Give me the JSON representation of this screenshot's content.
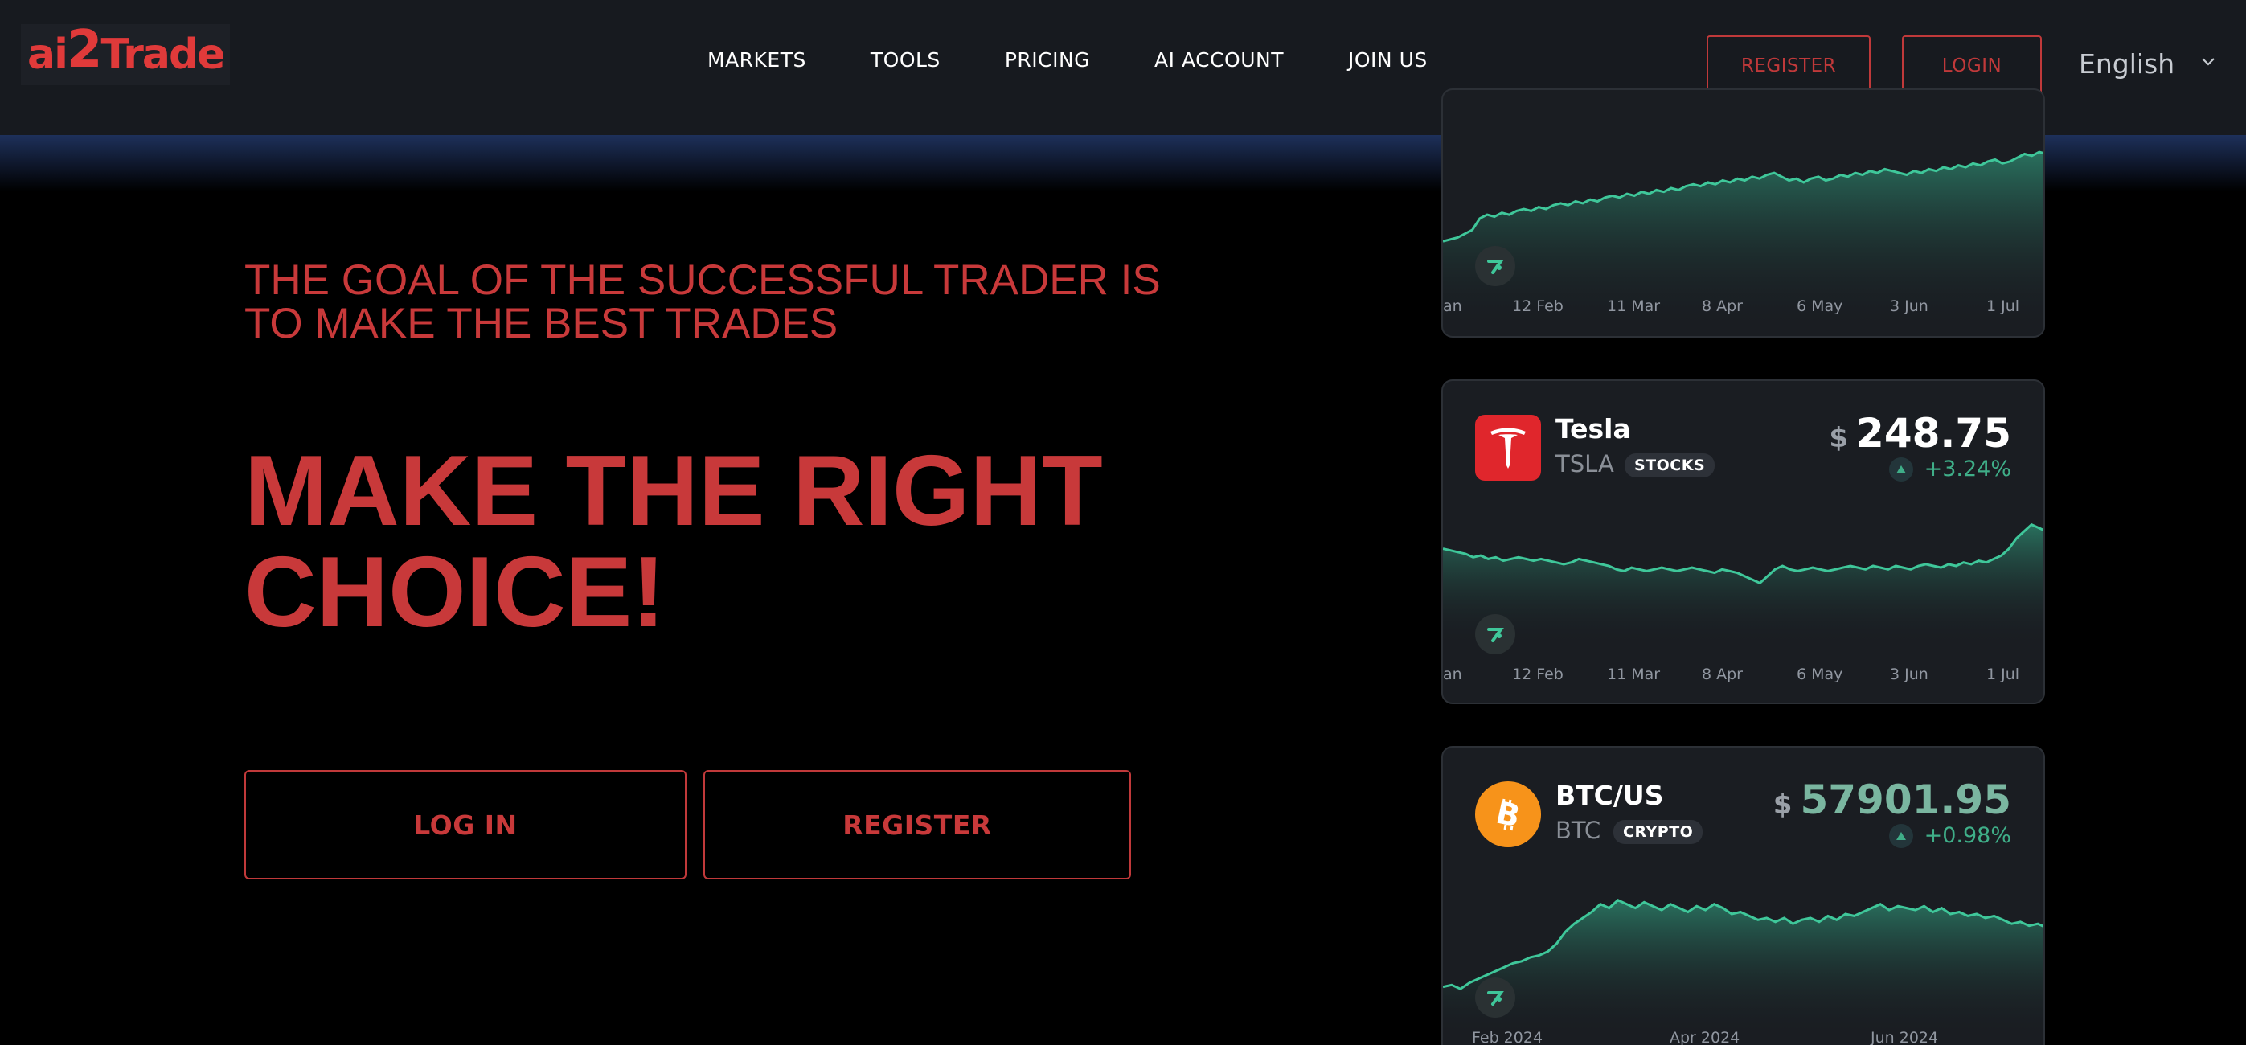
{
  "header": {
    "logo_text_a": "ai",
    "logo_text_b": "2",
    "logo_text_c": "Trade",
    "nav": [
      "MARKETS",
      "TOOLS",
      "PRICING",
      "AI ACCOUNT",
      "JOIN US"
    ],
    "register_label": "REGISTER",
    "login_label": "LOGIN",
    "language": "English"
  },
  "hero": {
    "tagline_line1": "THE GOAL OF THE SUCCESSFUL TRADER IS",
    "tagline_line2": "TO MAKE THE BEST TRADES",
    "headline_line1": "MAKE THE RIGHT",
    "headline_line2": "CHOICE!",
    "login_button": "LOG IN",
    "register_button": "REGISTER"
  },
  "colors": {
    "accent_red": "#c8393a",
    "chart_green": "#3fc79a",
    "header_bg": "#171a1f",
    "card_bg": "#1a1d22"
  },
  "cards": [
    {
      "axis_labels": [
        "an",
        "12 Feb",
        "11 Mar",
        "8 Apr",
        "6 May",
        "3 Jun",
        "1 Jul"
      ],
      "series": [
        30,
        31,
        32,
        34,
        36,
        42,
        44,
        43,
        45,
        44,
        46,
        47,
        46,
        48,
        47,
        49,
        50,
        49,
        51,
        50,
        52,
        51,
        53,
        54,
        53,
        55,
        54,
        56,
        55,
        57,
        56,
        58,
        57,
        59,
        60,
        59,
        61,
        60,
        62,
        61,
        63,
        62,
        64,
        63,
        65,
        66,
        64,
        62,
        63,
        61,
        63,
        64,
        62,
        63,
        65,
        64,
        66,
        65,
        67,
        66,
        68,
        67,
        66,
        65,
        67,
        66,
        68,
        67,
        69,
        68,
        70,
        69,
        71,
        70,
        72,
        73,
        71,
        72,
        74,
        76,
        75,
        77,
        76
      ]
    },
    {
      "name": "Tesla",
      "symbol": "TSLA",
      "badge": "STOCKS",
      "currency": "$",
      "price": "248.75",
      "change": "+3.24%",
      "logo_icon": "tesla-logo-icon",
      "axis_labels": [
        "an",
        "12 Feb",
        "11 Mar",
        "8 Apr",
        "6 May",
        "3 Jun",
        "1 Jul"
      ],
      "series": [
        52,
        51,
        50,
        49,
        47,
        48,
        46,
        47,
        45,
        46,
        47,
        46,
        45,
        46,
        45,
        44,
        43,
        44,
        46,
        45,
        44,
        43,
        42,
        40,
        39,
        41,
        40,
        39,
        40,
        41,
        40,
        39,
        40,
        41,
        40,
        39,
        38,
        40,
        39,
        38,
        36,
        34,
        32,
        36,
        40,
        42,
        40,
        39,
        40,
        41,
        40,
        39,
        40,
        41,
        42,
        41,
        40,
        42,
        41,
        40,
        42,
        41,
        40,
        42,
        43,
        42,
        41,
        43,
        42,
        44,
        43,
        45,
        44,
        46,
        48,
        52,
        58,
        62,
        66,
        64,
        62
      ]
    },
    {
      "name": "BTC/US",
      "symbol": "BTC",
      "badge": "CRYPTO",
      "currency": "$",
      "price": "57901.95",
      "change": "+0.98%",
      "logo_icon": "bitcoin-logo-icon",
      "axis_labels": [
        "Feb 2024",
        "Apr 2024",
        "Jun 2024"
      ],
      "series": [
        20,
        21,
        19,
        22,
        24,
        26,
        28,
        30,
        32,
        33,
        35,
        36,
        38,
        42,
        48,
        52,
        55,
        58,
        62,
        60,
        64,
        62,
        60,
        63,
        61,
        59,
        62,
        60,
        58,
        61,
        59,
        62,
        60,
        57,
        58,
        56,
        54,
        55,
        53,
        55,
        52,
        54,
        55,
        53,
        56,
        54,
        57,
        56,
        58,
        60,
        62,
        59,
        61,
        60,
        59,
        61,
        58,
        60,
        57,
        58,
        56,
        57,
        55,
        56,
        54,
        52,
        53,
        51,
        52,
        50
      ]
    }
  ]
}
